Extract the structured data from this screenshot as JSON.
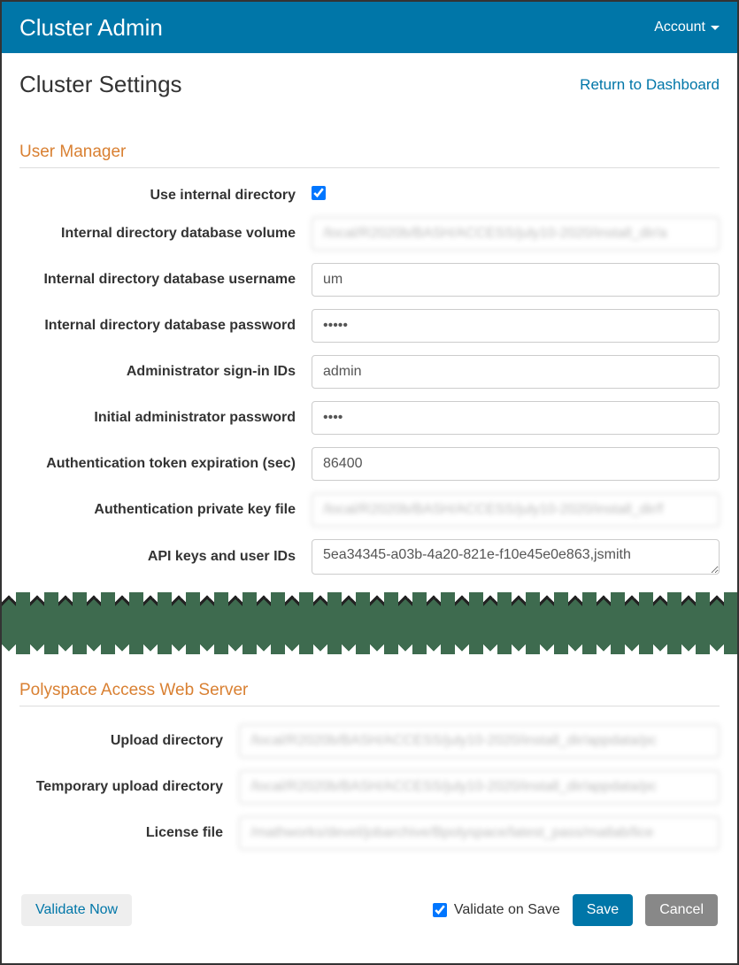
{
  "navbar": {
    "brand": "Cluster Admin",
    "account_label": "Account"
  },
  "page": {
    "title": "Cluster Settings",
    "return_link": "Return to Dashboard"
  },
  "user_manager": {
    "section_title": "User Manager",
    "use_internal_label": "Use internal directory",
    "use_internal_checked": true,
    "db_volume_label": "Internal directory database volume",
    "db_volume_value": "/local/R2020b/BASH/ACCESS/july10-2020/install_dir/a",
    "db_username_label": "Internal directory database username",
    "db_username_value": "um",
    "db_password_label": "Internal directory database password",
    "db_password_value": "•••••",
    "admin_ids_label": "Administrator sign-in IDs",
    "admin_ids_value": "admin",
    "init_admin_pw_label": "Initial administrator password",
    "init_admin_pw_value": "••••",
    "token_exp_label": "Authentication token expiration (sec)",
    "token_exp_value": "86400",
    "priv_key_label": "Authentication private key file",
    "priv_key_value": "/local/R2020b/BASH/ACCESS/july10-2020/install_dir/f",
    "api_keys_label": "API keys and user IDs",
    "api_keys_value": "5ea34345-a03b-4a20-821e-f10e45e0e863,jsmith"
  },
  "web_server": {
    "section_title": "Polyspace Access Web Server",
    "upload_dir_label": "Upload directory",
    "upload_dir_value": "/local/R2020b/BASH/ACCESS/july10-2020/install_dir/appdata/pc",
    "temp_upload_label": "Temporary upload directory",
    "temp_upload_value": "/local/R2020b/BASH/ACCESS/july10-2020/install_dir/appdata/pc",
    "license_label": "License file",
    "license_value": "/mathworks/devel/jobarchive/Bpolyspace/latest_pass/matlab/lice"
  },
  "footer": {
    "validate_now": "Validate Now",
    "validate_on_save": "Validate on Save",
    "validate_on_save_checked": true,
    "save": "Save",
    "cancel": "Cancel"
  }
}
